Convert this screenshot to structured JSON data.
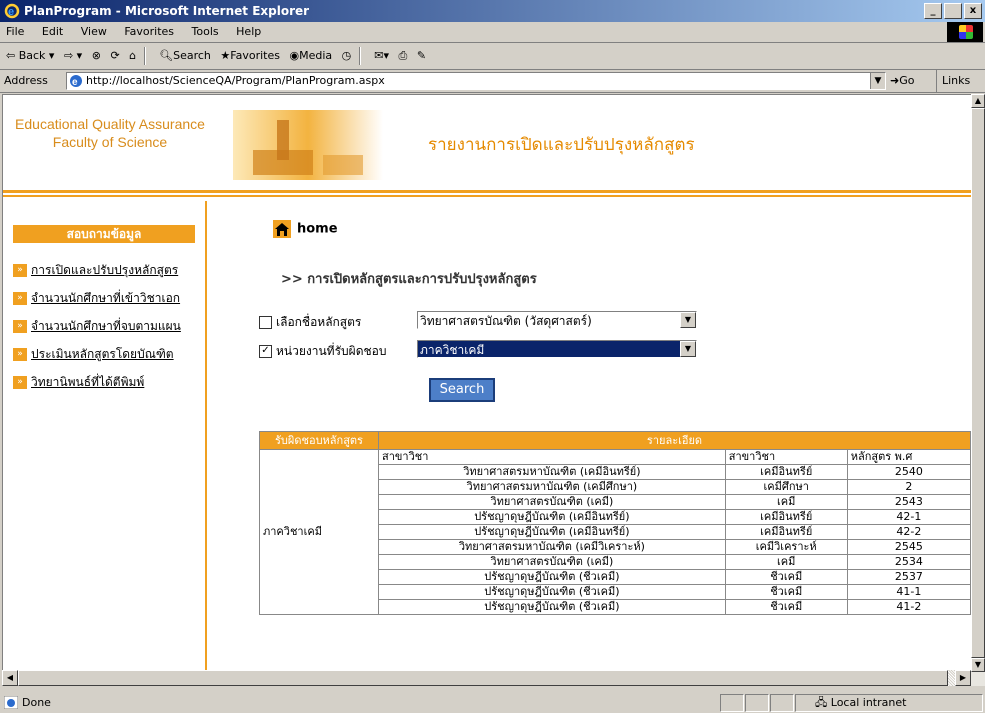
{
  "window": {
    "title": "PlanProgram - Microsoft Internet Explorer",
    "min": "_",
    "max": " ",
    "close": "x"
  },
  "menu": [
    "File",
    "Edit",
    "View",
    "Favorites",
    "Tools",
    "Help"
  ],
  "toolbar": {
    "back": "Back",
    "search": "Search",
    "favorites": "Favorites",
    "media": "Media"
  },
  "address": {
    "label": "Address",
    "url": "http://localhost/ScienceQA/Program/PlanProgram.aspx",
    "go": "Go",
    "links": "Links"
  },
  "banner": {
    "line1": "Educational Quality Assurance",
    "line2": "Faculty of Science",
    "title": "รายงานการเปิดและปรับปรุงหลักสูตร"
  },
  "sidebar": {
    "header": "สอบถามข้อมูล",
    "items": [
      "การเปิดและปรับปรุงหลักสูตร",
      "จำนวนนักศึกษาที่เข้าวิชาเอก",
      "จำนวนนักศึกษาที่จบตามแผน",
      "ประเมินหลักสูตรโดยบัณฑิต",
      "วิทยานิพนธ์ที่ได้ตีพิมพ์"
    ]
  },
  "home": {
    "label": "home"
  },
  "heading": ">> การเปิดหลักสูตรและการปรับปรุงหลักสูตร",
  "filters": {
    "program_label": "เลือกชื่อหลักสูตร",
    "program_checked": false,
    "program_value": "วิทยาศาสตรบัณฑิต (วัสดุศาสตร์)",
    "unit_label": "หน่วยงานที่รับผิดชอบ",
    "unit_checked": true,
    "unit_value": "ภาควิชาเคมี",
    "search_label": "Search"
  },
  "table": {
    "head": {
      "responsible": "รับผิดชอบหลักสูตร",
      "details": "รายละเอียด"
    },
    "sub": {
      "col1": "สาขาวิชา",
      "col2": "สาขาวิชา",
      "col3": "หลักสูตร พ.ศ"
    },
    "department": "ภาควิชาเคมี",
    "rows": [
      [
        "วิทยาศาสตรมหาบัณฑิต (เคมีอินทรีย์)",
        "เคมีอินทรีย์",
        "2540"
      ],
      [
        "วิทยาศาสตรมหาบัณฑิต (เคมีศึกษา)",
        "เคมีศึกษา",
        "2"
      ],
      [
        "วิทยาศาสตรบัณฑิต (เคมี)",
        "เคมี",
        "2543"
      ],
      [
        "ปรัชญาดุษฎีบัณฑิต (เคมีอินทรีย์)",
        "เคมีอินทรีย์",
        "42-1"
      ],
      [
        "ปรัชญาดุษฎีบัณฑิต (เคมีอินทรีย์)",
        "เคมีอินทรีย์",
        "42-2"
      ],
      [
        "วิทยาศาสตรมหาบัณฑิต (เคมีวิเคราะห์)",
        "เคมีวิเคราะห์",
        "2545"
      ],
      [
        "วิทยาศาสตรบัณฑิต (เคมี)",
        "เคมี",
        "2534"
      ],
      [
        "ปรัชญาดุษฎีบัณฑิต (ชีวเคมี)",
        "ชีวเคมี",
        "2537"
      ],
      [
        "ปรัชญาดุษฎีบัณฑิต (ชีวเคมี)",
        "ชีวเคมี",
        "41-1"
      ],
      [
        "ปรัชญาดุษฎีบัณฑิต (ชีวเคมี)",
        "ชีวเคมี",
        "41-2"
      ]
    ]
  },
  "status": {
    "text": "Done",
    "zone": "Local intranet"
  },
  "colors": {
    "accent": "#f0a020",
    "titlebar": "#0a246a",
    "button": "#4d7fc8"
  }
}
